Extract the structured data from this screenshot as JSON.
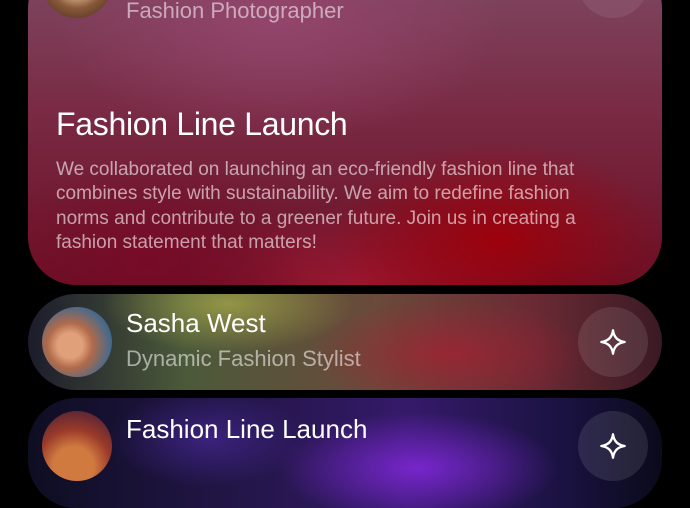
{
  "top_card": {
    "profile_role": "Fashion Photographer",
    "heading": "Fashion Line Launch",
    "description": "We collaborated on launching an eco-friendly fashion line that combines style with sustainability. We aim to redefine fashion norms and contribute to a greener future. Join us in creating a fashion statement that matters!",
    "action_icon": "sparkle-icon"
  },
  "cards": [
    {
      "name": "Sasha West",
      "role": "Dynamic Fashion Stylist",
      "action_icon": "sparkle-icon"
    },
    {
      "name": "Fashion Line Launch",
      "action_icon": "sparkle-icon"
    }
  ]
}
